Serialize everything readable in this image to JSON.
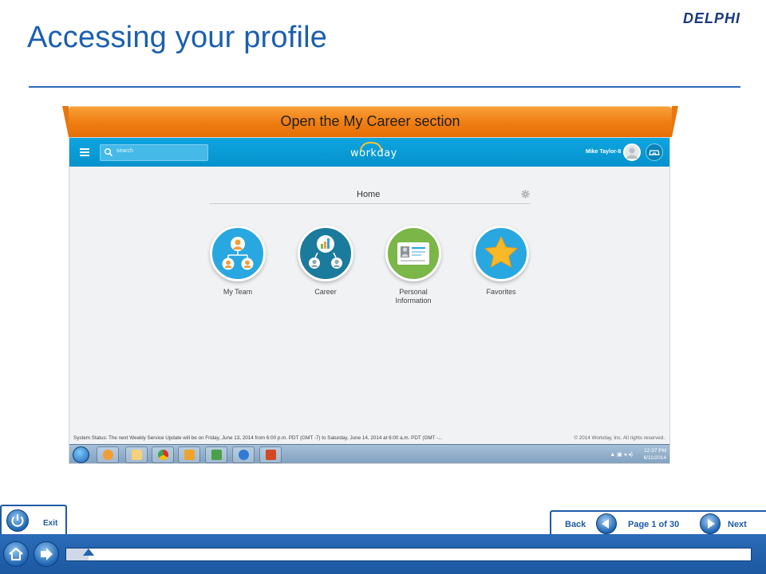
{
  "slide": {
    "title": "Accessing your profile",
    "logo": "DELPHI",
    "instruction": "Open the My Career section"
  },
  "workday": {
    "search_placeholder": "search",
    "logo_text": "workday",
    "user_name": "Mike Taylor-8",
    "home_label": "Home",
    "tiles": [
      {
        "label": "My Team",
        "color": "#29a7e1",
        "icon": "my-team-icon"
      },
      {
        "label": "Career",
        "color": "#1b7b9c",
        "icon": "career-icon"
      },
      {
        "label": "Personal Information",
        "color": "#7ab648",
        "icon": "personal-information-icon"
      },
      {
        "label": "Favorites",
        "color": "#29a7e1",
        "icon": "favorites-icon"
      }
    ],
    "system_status": "System Status: The next Weekly Service Update will be on Friday, June 13, 2014 from 6:00 p.m. PDT (GMT -7) to Saturday, June 14, 2014 at 6:00 a.m. PDT (GMT -...",
    "copyright": "© 2014 Workday, Inc. All rights reserved."
  },
  "taskbar": {
    "time": "12:37 PM",
    "date": "6/11/2014",
    "apps": [
      "media-player-icon",
      "file-explorer-icon",
      "chrome-icon",
      "outlook-icon",
      "lync-icon",
      "internet-explorer-icon",
      "powerpoint-icon"
    ]
  },
  "player": {
    "exit_label": "Exit",
    "back_label": "Back",
    "page_label": "Page 1 of 30",
    "next_label": "Next",
    "progress_fraction": 0.033
  },
  "colors": {
    "title_blue": "#1b5fb1",
    "banner_orange": "#ef7d12",
    "workday_blue": "#0592cc",
    "player_blue": "#1d5ba8"
  }
}
